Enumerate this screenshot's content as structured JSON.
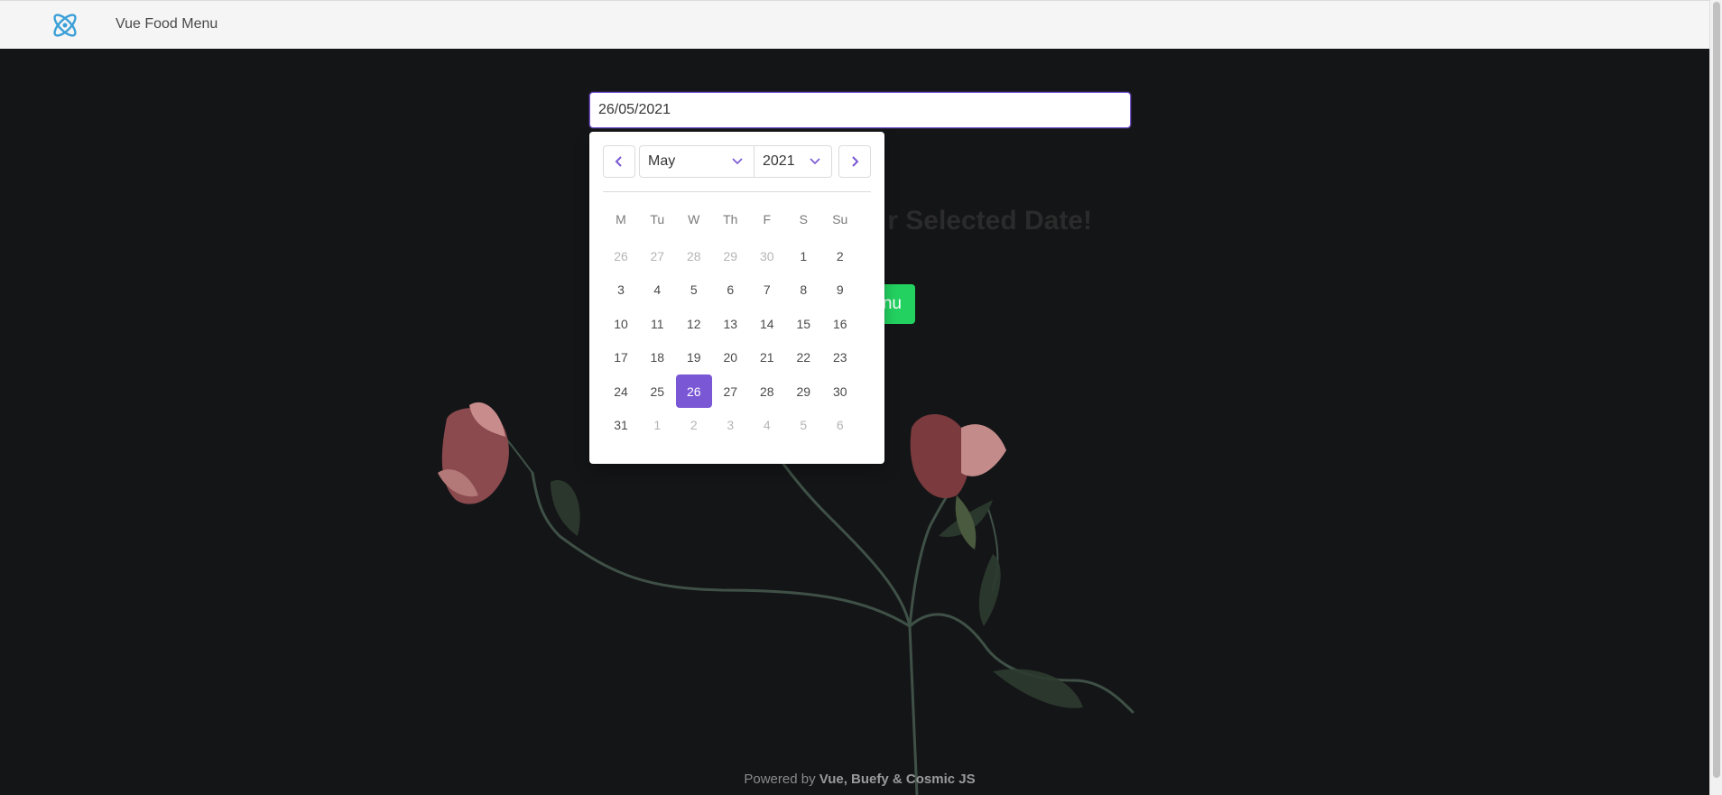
{
  "navbar": {
    "title": "Vue Food Menu"
  },
  "date_input": {
    "value": "26/05/2021"
  },
  "headline": {
    "text": "r Selected Date!"
  },
  "menu_button": {
    "label": "nu"
  },
  "datepicker": {
    "month": "May",
    "year": "2021",
    "weekdays": [
      "M",
      "Tu",
      "W",
      "Th",
      "F",
      "S",
      "Su"
    ],
    "weeks": [
      [
        {
          "d": "26",
          "o": true
        },
        {
          "d": "27",
          "o": true
        },
        {
          "d": "28",
          "o": true
        },
        {
          "d": "29",
          "o": true
        },
        {
          "d": "30",
          "o": true
        },
        {
          "d": "1"
        },
        {
          "d": "2"
        }
      ],
      [
        {
          "d": "3"
        },
        {
          "d": "4"
        },
        {
          "d": "5"
        },
        {
          "d": "6"
        },
        {
          "d": "7"
        },
        {
          "d": "8"
        },
        {
          "d": "9"
        }
      ],
      [
        {
          "d": "10"
        },
        {
          "d": "11"
        },
        {
          "d": "12"
        },
        {
          "d": "13"
        },
        {
          "d": "14"
        },
        {
          "d": "15"
        },
        {
          "d": "16"
        }
      ],
      [
        {
          "d": "17"
        },
        {
          "d": "18"
        },
        {
          "d": "19"
        },
        {
          "d": "20"
        },
        {
          "d": "21"
        },
        {
          "d": "22"
        },
        {
          "d": "23"
        }
      ],
      [
        {
          "d": "24"
        },
        {
          "d": "25"
        },
        {
          "d": "26",
          "s": true
        },
        {
          "d": "27"
        },
        {
          "d": "28"
        },
        {
          "d": "29"
        },
        {
          "d": "30"
        }
      ],
      [
        {
          "d": "31"
        },
        {
          "d": "1",
          "o": true
        },
        {
          "d": "2",
          "o": true
        },
        {
          "d": "3",
          "o": true
        },
        {
          "d": "4",
          "o": true
        },
        {
          "d": "5",
          "o": true
        },
        {
          "d": "6",
          "o": true
        }
      ]
    ]
  },
  "footer": {
    "prefix": "Powered by ",
    "strong": "Vue, Buefy & Cosmic JS"
  },
  "colors": {
    "accent": "#7957d5",
    "success": "#23d160",
    "background": "#141517",
    "navbar": "#f5f5f5"
  },
  "icons": [
    "atom-logo-icon",
    "chevron-left-icon",
    "chevron-right-icon",
    "chevron-down-icon"
  ]
}
